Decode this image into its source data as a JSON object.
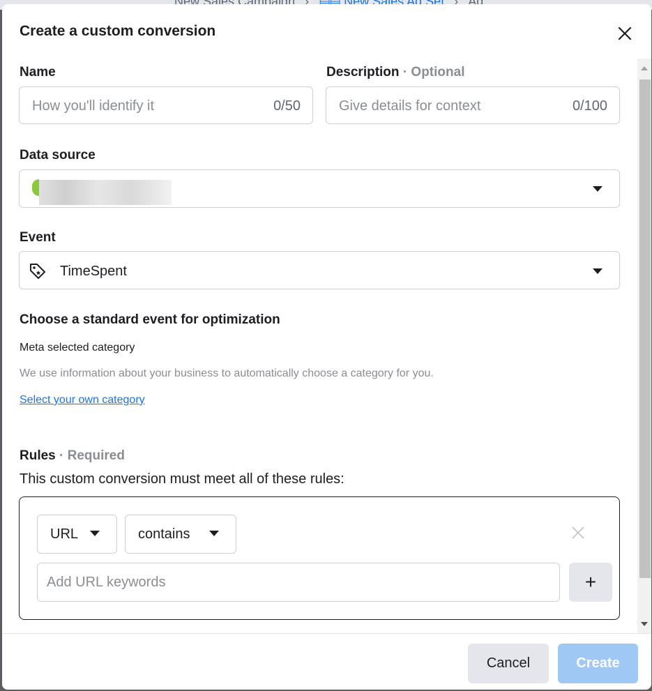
{
  "background": {
    "breadcrumb_campaign": "New Sales Campaign",
    "breadcrumb_adset": "New Sales Ad Set",
    "breadcrumb_ad": "Ad"
  },
  "modal": {
    "title": "Create a custom conversion",
    "close_icon": "close-icon"
  },
  "name_field": {
    "label": "Name",
    "placeholder": "How you'll identify it",
    "counter": "0/50"
  },
  "description_field": {
    "label": "Description",
    "label_suffix": "· Optional",
    "placeholder": "Give details for context",
    "counter": "0/100"
  },
  "data_source": {
    "label": "Data source",
    "icon": "data-source-logo"
  },
  "event": {
    "label": "Event",
    "icon": "tag-icon",
    "value": "TimeSpent"
  },
  "optimization": {
    "title": "Choose a standard event for optimization",
    "category": "Meta selected category",
    "help": "We use information about your business to automatically choose a category for you.",
    "link": "Select your own category"
  },
  "rules": {
    "label": "Rules",
    "label_suffix": "· Required",
    "description": "This custom conversion must meet all of these rules:",
    "field_select": "URL",
    "operator_select": "contains",
    "keyword_placeholder": "Add URL keywords",
    "add_icon": "+"
  },
  "footer": {
    "cancel_label": "Cancel",
    "create_label": "Create"
  },
  "colors": {
    "link_blue": "#1b74e4",
    "create_disabled": "#9fc8f5",
    "muted_text": "#8a8d91"
  }
}
